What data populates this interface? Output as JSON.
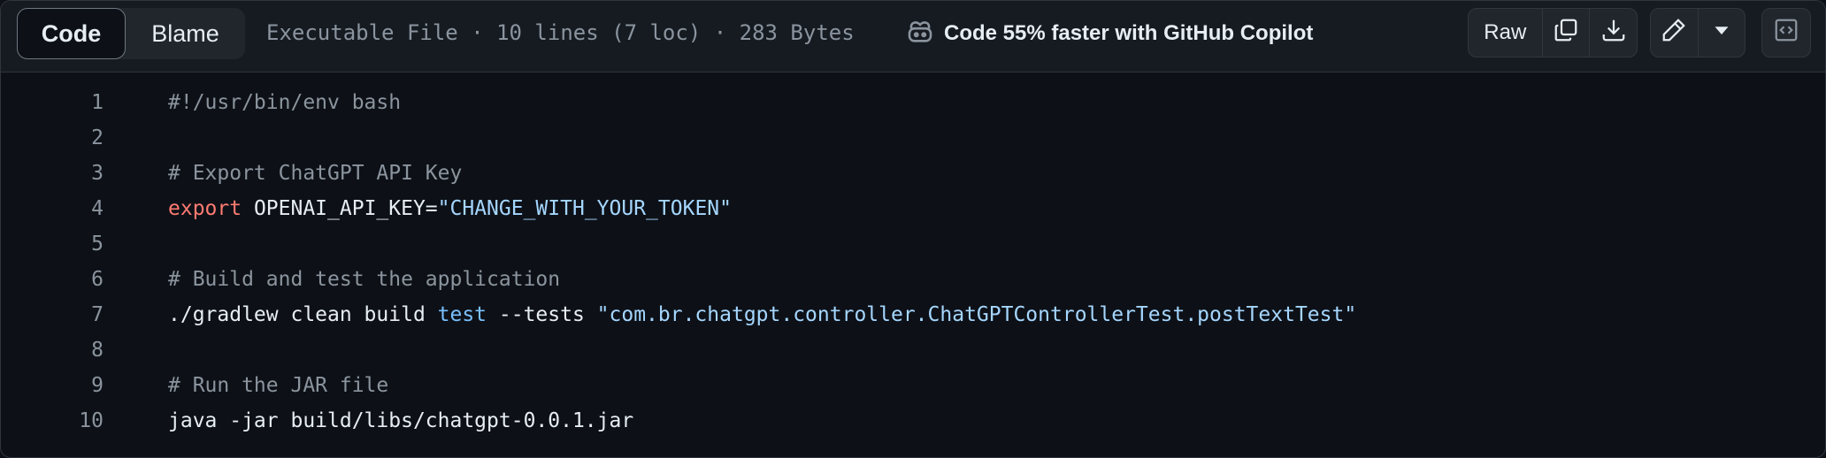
{
  "tabs": {
    "code": "Code",
    "blame": "Blame"
  },
  "file_meta": "Executable File · 10 lines (7 loc) · 283 Bytes",
  "copilot_text": "Code 55% faster with GitHub Copilot",
  "toolbar": {
    "raw_label": "Raw",
    "icons": [
      "copy-icon",
      "download-icon",
      "pencil-icon",
      "triangle-down-icon",
      "code-square-icon"
    ]
  },
  "colors": {
    "background": "#0d1117",
    "header": "#161b22",
    "border": "#30363d",
    "comment": "#8b949e",
    "keyword": "#ff7b72",
    "string": "#a5d6ff",
    "builtin": "#79c0ff"
  },
  "code_lines": [
    {
      "n": "1",
      "tokens": [
        {
          "t": "#!/usr/bin/env bash",
          "c": "comment"
        }
      ]
    },
    {
      "n": "2",
      "tokens": []
    },
    {
      "n": "3",
      "tokens": [
        {
          "t": "# Export ChatGPT API Key",
          "c": "comment"
        }
      ]
    },
    {
      "n": "4",
      "tokens": [
        {
          "t": "export",
          "c": "kw"
        },
        {
          "t": " OPENAI_API_KEY=",
          "c": ""
        },
        {
          "t": "\"CHANGE_WITH_YOUR_TOKEN\"",
          "c": "str"
        }
      ]
    },
    {
      "n": "5",
      "tokens": []
    },
    {
      "n": "6",
      "tokens": [
        {
          "t": "# Build and test the application",
          "c": "comment"
        }
      ]
    },
    {
      "n": "7",
      "tokens": [
        {
          "t": "./gradlew clean build ",
          "c": ""
        },
        {
          "t": "test",
          "c": "builtin"
        },
        {
          "t": " --tests ",
          "c": ""
        },
        {
          "t": "\"com.br.chatgpt.controller.ChatGPTControllerTest.postTextTest\"",
          "c": "str"
        }
      ]
    },
    {
      "n": "8",
      "tokens": []
    },
    {
      "n": "9",
      "tokens": [
        {
          "t": "# Run the JAR file",
          "c": "comment"
        }
      ]
    },
    {
      "n": "10",
      "tokens": [
        {
          "t": "java -jar build/libs/chatgpt-0.0.1.jar",
          "c": ""
        }
      ]
    }
  ]
}
